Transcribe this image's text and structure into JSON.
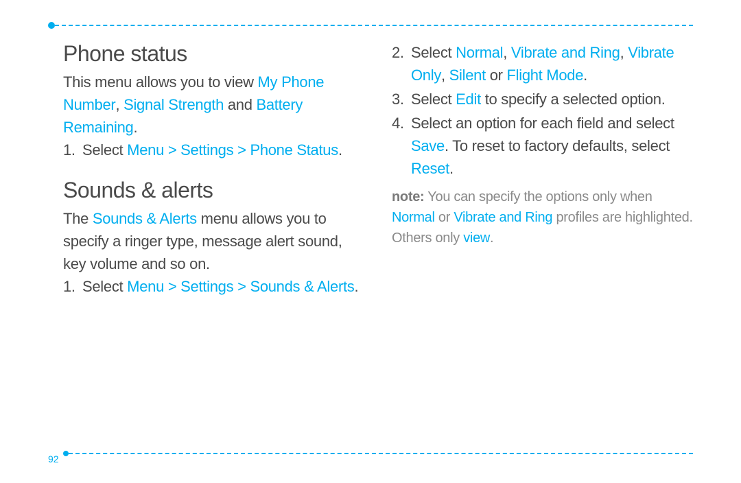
{
  "page_number": "92",
  "left": {
    "section1": {
      "heading": "Phone status",
      "intro_pre": "This menu allows you to view ",
      "intro_accent1": "My Phone Number",
      "intro_comma": ", ",
      "intro_accent2": "Signal Strength",
      "intro_and": " and ",
      "intro_accent3": "Battery Remaining",
      "intro_period": ".",
      "step1_num": "1.",
      "step1_pre": " Select ",
      "step1_accent": "Menu > Settings > Phone Status",
      "step1_period": "."
    },
    "section2": {
      "heading": "Sounds & alerts",
      "intro_pre": "The ",
      "intro_accent": "Sounds & Alerts",
      "intro_post": " menu allows you to specify a ringer type, message alert sound, key volume and so on.",
      "step1_num": "1.",
      "step1_pre": " Select ",
      "step1_accent": "Menu > Settings > Sounds & Alerts",
      "step1_period": "."
    }
  },
  "right": {
    "step2_num": "2.",
    "step2_pre": "Select ",
    "step2_a1": "Normal",
    "step2_c1": ", ",
    "step2_a2": "Vibrate and Ring",
    "step2_c2": ", ",
    "step2_a3": "Vibrate Only",
    "step2_c3": ", ",
    "step2_a4": "Silent",
    "step2_or": " or ",
    "step2_a5": "Flight Mode",
    "step2_period": ".",
    "step3_num": "3.",
    "step3_pre": "Select ",
    "step3_accent": "Edit",
    "step3_post": " to specify a selected option.",
    "step4_num": "4.",
    "step4_pre": "Select an option for each field and select ",
    "step4_accent1": "Save",
    "step4_mid": ". To reset to factory defaults, select ",
    "step4_accent2": "Reset",
    "step4_period": ".",
    "note_label": "note:",
    "note_pre": " You can specify the options only when ",
    "note_a1": "Normal",
    "note_or": " or ",
    "note_a2": "Vibrate and Ring",
    "note_mid": " profiles are highlighted. Others only ",
    "note_a3": "view",
    "note_period": "."
  }
}
